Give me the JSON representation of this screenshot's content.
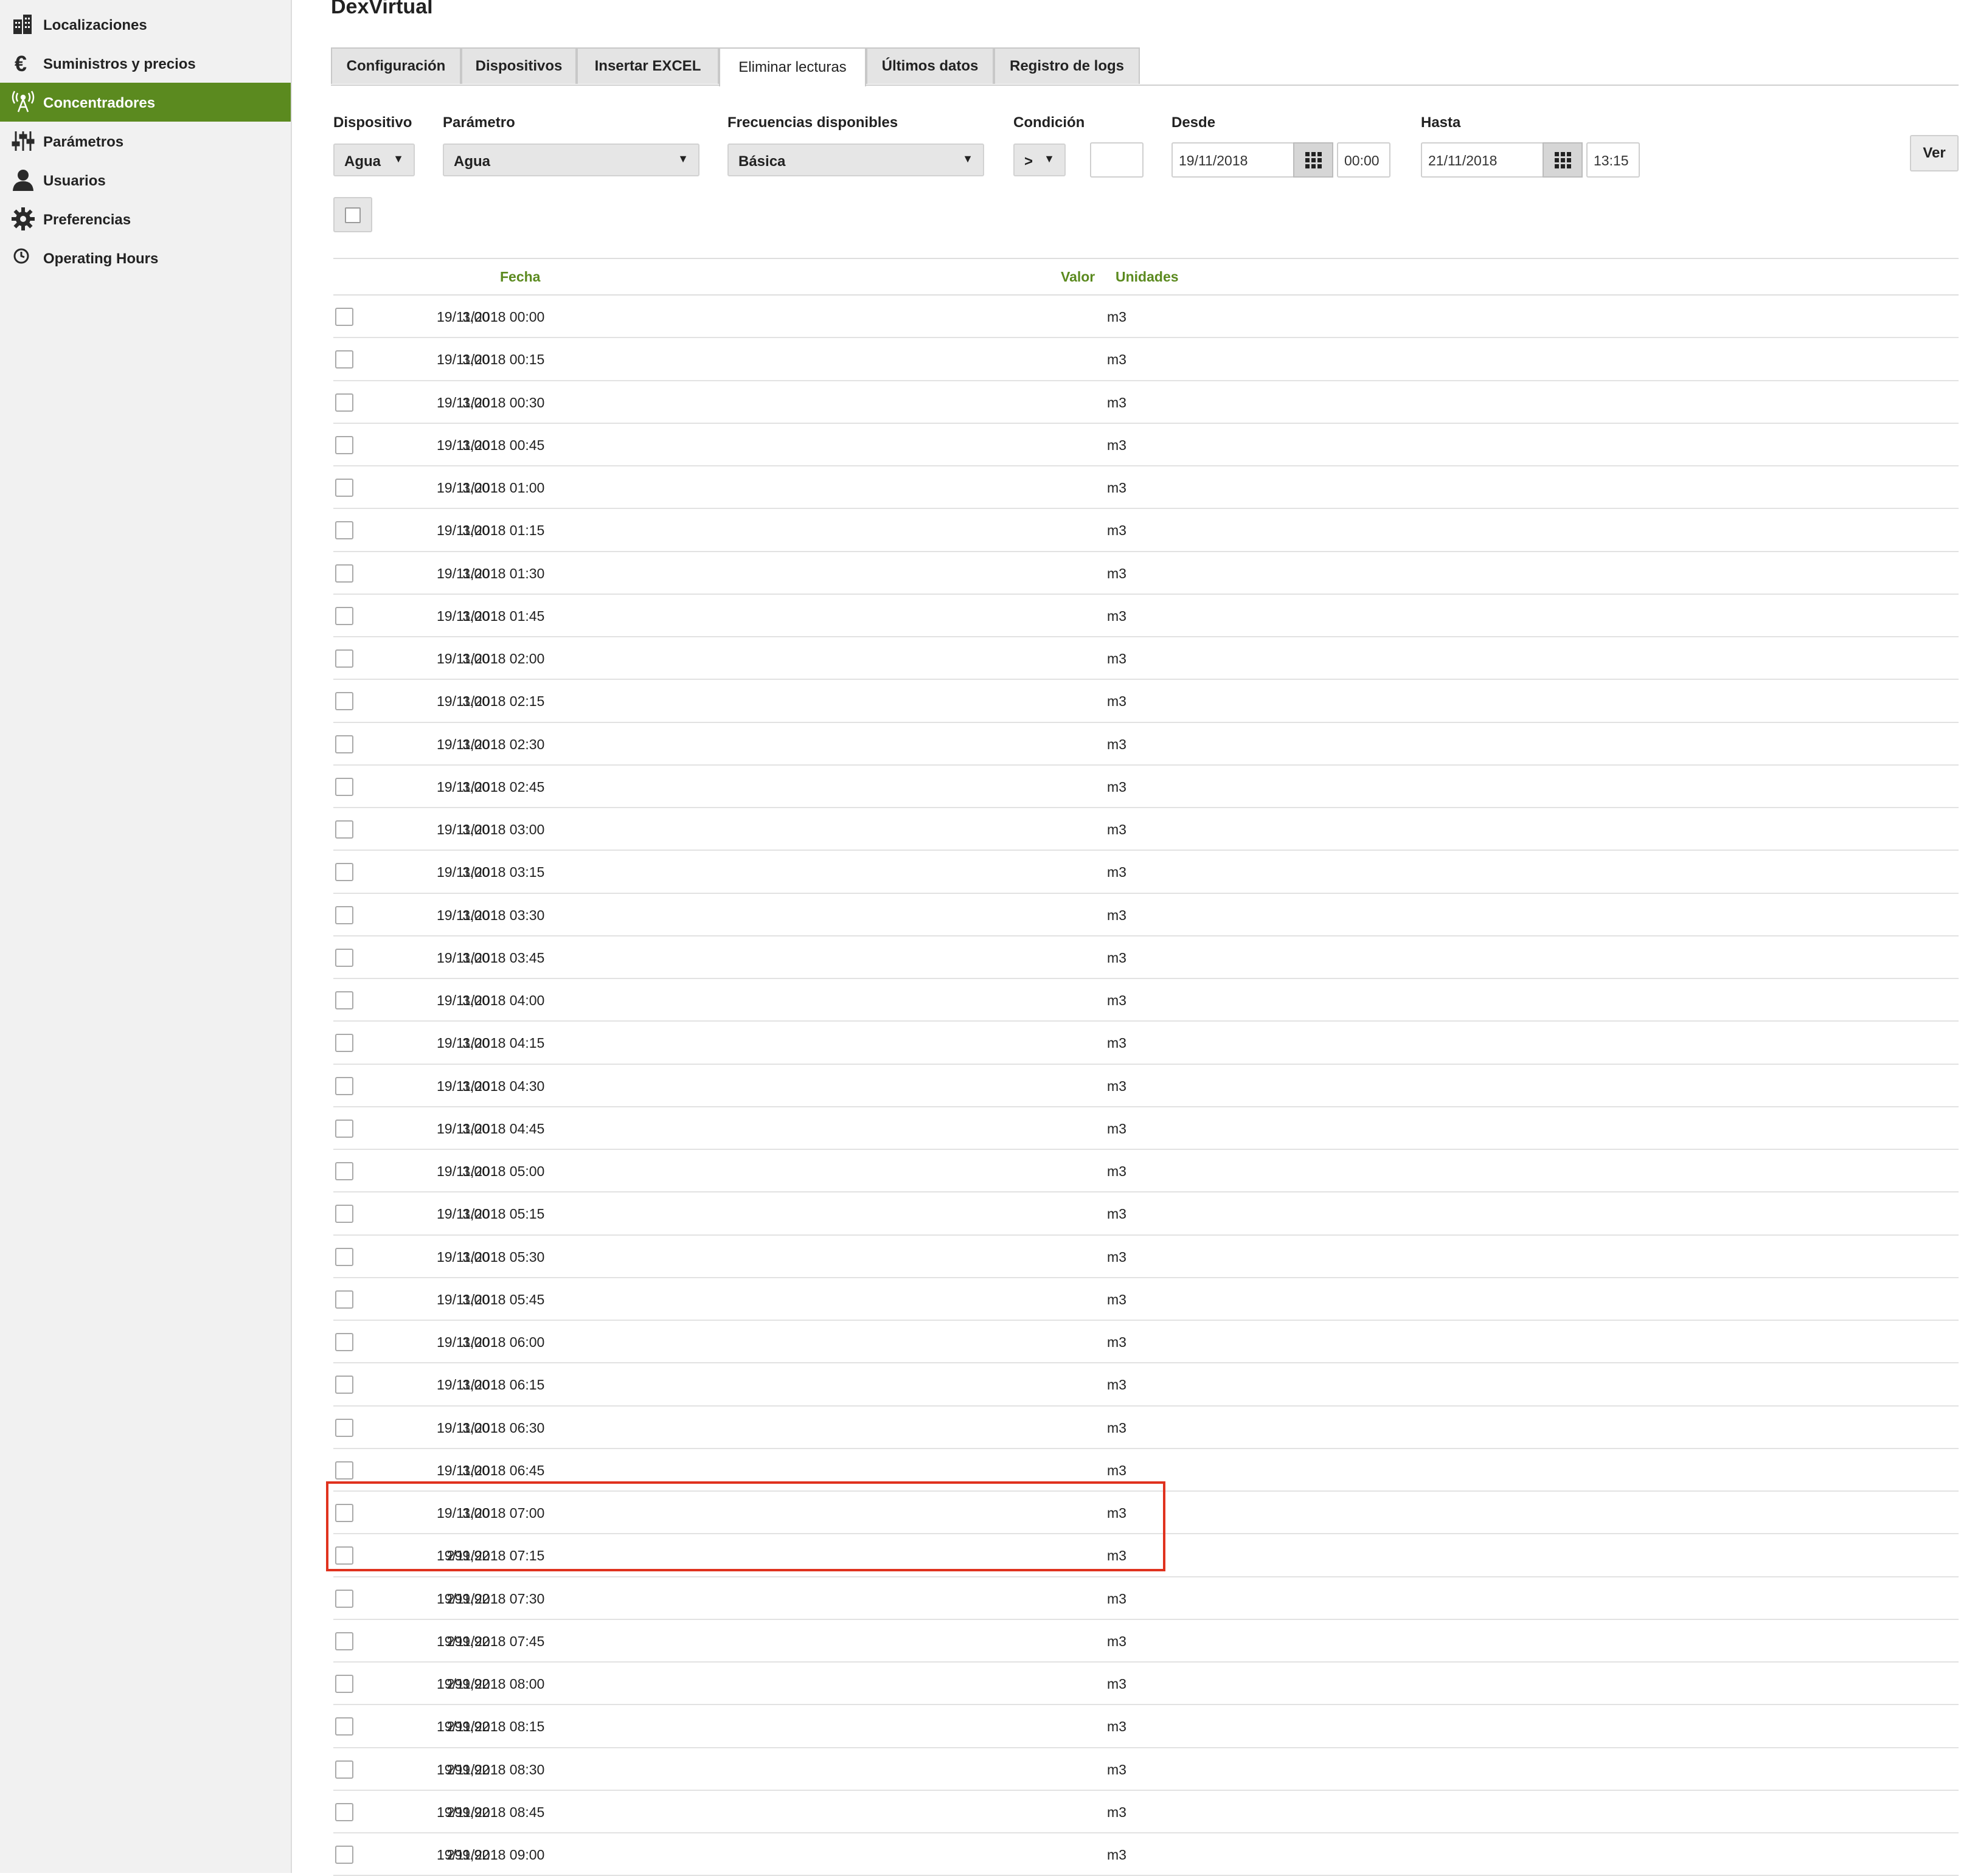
{
  "app_title": "DexVirtual",
  "sidebar": {
    "items": [
      {
        "label": "Localizaciones",
        "icon": "buildings-icon",
        "active": false
      },
      {
        "label": "Suministros y precios",
        "icon": "euro-icon",
        "active": false
      },
      {
        "label": "Concentradores",
        "icon": "antenna-icon",
        "active": true
      },
      {
        "label": "Parámetros",
        "icon": "sliders-icon",
        "active": false
      },
      {
        "label": "Usuarios",
        "icon": "user-icon",
        "active": false
      },
      {
        "label": "Preferencias",
        "icon": "gear-icon",
        "active": false
      },
      {
        "label": "Operating Hours",
        "icon": "clock-icon",
        "active": false
      }
    ]
  },
  "tabs": [
    {
      "label": "Configuración",
      "active": false
    },
    {
      "label": "Dispositivos",
      "active": false
    },
    {
      "label": "Insertar EXCEL",
      "active": false
    },
    {
      "label": "Eliminar lecturas",
      "active": true
    },
    {
      "label": "Últimos datos",
      "active": false
    },
    {
      "label": "Registro de logs",
      "active": false
    }
  ],
  "filters": {
    "dispositivo": {
      "label": "Dispositivo",
      "value": "Agua"
    },
    "parametro": {
      "label": "Parámetro",
      "value": "Agua"
    },
    "frecuencias": {
      "label": "Frecuencias disponibles",
      "value": "Básica"
    },
    "condicion": {
      "label": "Condición",
      "operator": ">",
      "value": ""
    },
    "desde": {
      "label": "Desde",
      "date": "19/11/2018",
      "time": "00:00"
    },
    "hasta": {
      "label": "Hasta",
      "date": "21/11/2018",
      "time": "13:15"
    },
    "ver_label": "Ver"
  },
  "table": {
    "headers": {
      "fecha": "Fecha",
      "valor": "Valor",
      "unidades": "Unidades"
    },
    "rows": [
      {
        "fecha": "19/11/2018 00:00",
        "valor": "3,00",
        "unidades": "m3"
      },
      {
        "fecha": "19/11/2018 00:15",
        "valor": "3,00",
        "unidades": "m3"
      },
      {
        "fecha": "19/11/2018 00:30",
        "valor": "3,00",
        "unidades": "m3"
      },
      {
        "fecha": "19/11/2018 00:45",
        "valor": "3,00",
        "unidades": "m3"
      },
      {
        "fecha": "19/11/2018 01:00",
        "valor": "3,00",
        "unidades": "m3"
      },
      {
        "fecha": "19/11/2018 01:15",
        "valor": "3,00",
        "unidades": "m3"
      },
      {
        "fecha": "19/11/2018 01:30",
        "valor": "3,00",
        "unidades": "m3"
      },
      {
        "fecha": "19/11/2018 01:45",
        "valor": "3,00",
        "unidades": "m3"
      },
      {
        "fecha": "19/11/2018 02:00",
        "valor": "3,00",
        "unidades": "m3"
      },
      {
        "fecha": "19/11/2018 02:15",
        "valor": "3,00",
        "unidades": "m3"
      },
      {
        "fecha": "19/11/2018 02:30",
        "valor": "3,00",
        "unidades": "m3"
      },
      {
        "fecha": "19/11/2018 02:45",
        "valor": "3,00",
        "unidades": "m3"
      },
      {
        "fecha": "19/11/2018 03:00",
        "valor": "3,00",
        "unidades": "m3"
      },
      {
        "fecha": "19/11/2018 03:15",
        "valor": "3,00",
        "unidades": "m3"
      },
      {
        "fecha": "19/11/2018 03:30",
        "valor": "3,00",
        "unidades": "m3"
      },
      {
        "fecha": "19/11/2018 03:45",
        "valor": "3,00",
        "unidades": "m3"
      },
      {
        "fecha": "19/11/2018 04:00",
        "valor": "3,00",
        "unidades": "m3"
      },
      {
        "fecha": "19/11/2018 04:15",
        "valor": "3,00",
        "unidades": "m3"
      },
      {
        "fecha": "19/11/2018 04:30",
        "valor": "3,00",
        "unidades": "m3"
      },
      {
        "fecha": "19/11/2018 04:45",
        "valor": "3,00",
        "unidades": "m3"
      },
      {
        "fecha": "19/11/2018 05:00",
        "valor": "3,00",
        "unidades": "m3"
      },
      {
        "fecha": "19/11/2018 05:15",
        "valor": "3,00",
        "unidades": "m3"
      },
      {
        "fecha": "19/11/2018 05:30",
        "valor": "3,00",
        "unidades": "m3"
      },
      {
        "fecha": "19/11/2018 05:45",
        "valor": "3,00",
        "unidades": "m3"
      },
      {
        "fecha": "19/11/2018 06:00",
        "valor": "3,00",
        "unidades": "m3"
      },
      {
        "fecha": "19/11/2018 06:15",
        "valor": "3,00",
        "unidades": "m3"
      },
      {
        "fecha": "19/11/2018 06:30",
        "valor": "3,00",
        "unidades": "m3"
      },
      {
        "fecha": "19/11/2018 06:45",
        "valor": "3,00",
        "unidades": "m3"
      },
      {
        "fecha": "19/11/2018 07:00",
        "valor": "3,00",
        "unidades": "m3"
      },
      {
        "fecha": "19/11/2018 07:15",
        "valor": "299,92",
        "unidades": "m3"
      },
      {
        "fecha": "19/11/2018 07:30",
        "valor": "299,92",
        "unidades": "m3"
      },
      {
        "fecha": "19/11/2018 07:45",
        "valor": "299,92",
        "unidades": "m3"
      },
      {
        "fecha": "19/11/2018 08:00",
        "valor": "299,92",
        "unidades": "m3"
      },
      {
        "fecha": "19/11/2018 08:15",
        "valor": "299,92",
        "unidades": "m3"
      },
      {
        "fecha": "19/11/2018 08:30",
        "valor": "299,92",
        "unidades": "m3"
      },
      {
        "fecha": "19/11/2018 08:45",
        "valor": "299,92",
        "unidades": "m3"
      },
      {
        "fecha": "19/11/2018 09:00",
        "valor": "299,92",
        "unidades": "m3"
      }
    ]
  },
  "colors": {
    "accent": "#5b8a1f",
    "highlight": "#e0321e"
  }
}
